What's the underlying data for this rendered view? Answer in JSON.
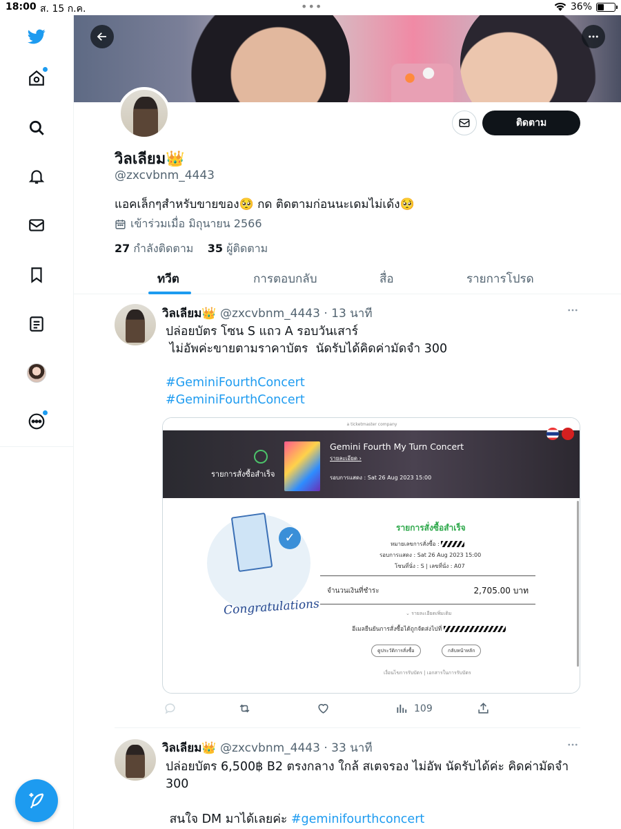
{
  "status_bar": {
    "time": "18:00",
    "date": "ส. 15 ก.ค.",
    "dots": "•••",
    "battery_percent": "36%",
    "battery_level": 0.36
  },
  "sidebar": {
    "items": [
      {
        "name": "twitter-logo-icon"
      },
      {
        "name": "home-icon",
        "has_dot": true
      },
      {
        "name": "search-icon"
      },
      {
        "name": "notifications-icon"
      },
      {
        "name": "messages-icon"
      },
      {
        "name": "bookmarks-icon"
      },
      {
        "name": "lists-icon"
      },
      {
        "name": "profile-icon"
      },
      {
        "name": "more-icon",
        "has_dot": true
      }
    ],
    "compose_icon": "compose-feather-icon"
  },
  "profile": {
    "display_name": "วิลเลียม👑",
    "handle": "@zxcvbnm_4443",
    "bio": "แอคเล็กๆสำหรับขายของ🥺 กด ติดตามก่อนนะเดมไม่เด้ง🥺",
    "joined": "เข้าร่วมเมื่อ มิถุนายน 2566",
    "following_count": "27",
    "following_label": "กำลังติดตาม",
    "followers_count": "35",
    "followers_label": "ผู้ติดตาม",
    "follow_button": "ติดตาม"
  },
  "tabs": [
    {
      "label": "ทวีต",
      "active": true
    },
    {
      "label": "การตอบกลับ",
      "active": false
    },
    {
      "label": "สื่อ",
      "active": false
    },
    {
      "label": "รายการโปรด",
      "active": false
    }
  ],
  "tweets": [
    {
      "name": "วิลเลียม👑",
      "handle": "@zxcvbnm_4443",
      "time": "· 13 นาที",
      "line1": "ปล่อยบัตร โซน S แถว A รอบวันเสาร์",
      "line2": " ไม่อัพค่ะขายตามราคาบัตร  นัดรับได้คิดค่ามัดจำ 300",
      "hashtag1": "#GeminiFourthConcert",
      "hashtag2": "#GeminiFourthConcert",
      "media": {
        "top_caption": "a ticketmaster company",
        "success_label": "รายการสั่งซื้อสำเร็จ",
        "concert_title": "Gemini Fourth My Turn Concert",
        "detail_link": "รายละเอียด ›",
        "show_date": "รอบการแสดง  : Sat 26 Aug 2023 15:00",
        "order_success": "รายการสั่งซื้อสำเร็จ",
        "order_number_label": "หมายเลขการสั่งซื้อ :",
        "show_round": "รอบการแสดง : Sat 26 Aug 2023 15:00",
        "seat": "โซนที่นั่ง : S  |  เลขที่นั่ง : A07",
        "amount_label": "จำนวนเงินที่ชำระ",
        "amount_value": "2,705.00 บาท",
        "more_detail": "⌄ รายละเอียดเพิ่มเติม",
        "email_confirm": "อีเมลยืนยันการสั่งซื้อได้ถูกจัดส่งไปที่",
        "btn_history": "ดูประวัติการสั่งซื้อ",
        "btn_home": "กลับหน้าหลัก",
        "footer_links": "เงื่อนไขการรับบัตร  |  เอกสารในการรับบัตร",
        "congrats": "Congratulations"
      },
      "views": "109"
    },
    {
      "name": "วิลเลียม👑",
      "handle": "@zxcvbnm_4443",
      "time": "· 33 นาที",
      "line1": "ปล่อยบัตร 6,500฿ B2 ตรงกลาง ใกล้ สเตจรอง ไม่อัพ นัดรับได้ค่ะ คิดค่ามัดจำ",
      "line2": "300",
      "line3": " สนใจ DM มาได้เลยค่ะ ",
      "hashtag": "#geminifourthconcert"
    }
  ],
  "colors": {
    "accent": "#1d9bf0",
    "text": "#0f1419",
    "secondary": "#536471",
    "success_green": "#2da84a"
  }
}
